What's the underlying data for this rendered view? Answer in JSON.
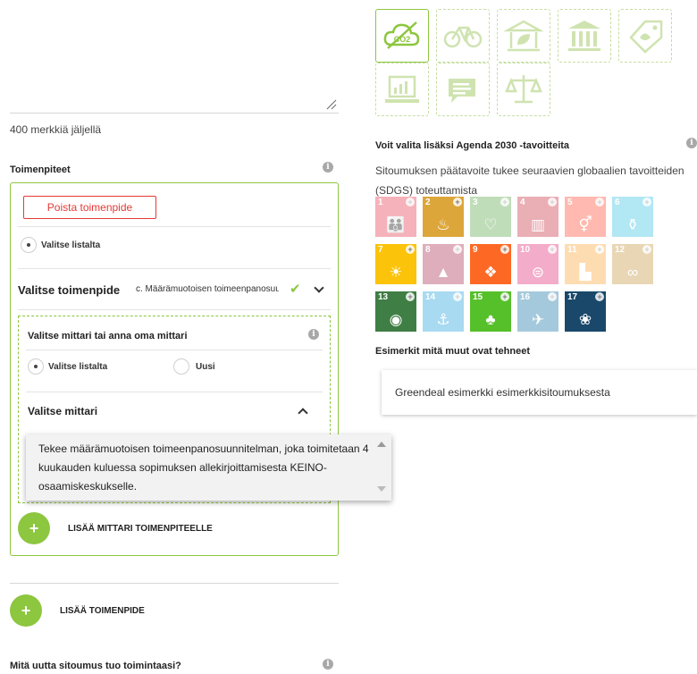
{
  "form": {
    "chars_left": "400 merkkiä jäljellä",
    "measures_label": "Toimenpiteet",
    "remove_measure": "Poista toimenpide",
    "choose_from_list": "Valitse listalta",
    "select_measure_label": "Valitse toimenpide",
    "select_measure_value": "c.   Määrämuotoisen toimeenpanosuunnitelman",
    "metric_title": "Valitse mittari tai anna oma mittari",
    "metric_from_list": "Valitse listalta",
    "metric_new": "Uusi",
    "select_metric": "Valitse mittari",
    "dropdown_option": "Tekee määrämuotoisen toimeenpanosuunnitelman, joka toimitetaan 4 kuukauden kuluessa sopimuksen allekirjoittamisesta KEINO-osaamiskeskukselle.",
    "add_metric": "LISÄÄ MITTARI TOIMENPITEELLE",
    "add_measure": "LISÄÄ TOIMENPIDE",
    "what_new": "Mitä uutta sitoumus tuo toimintaasi?",
    "info_glyph": "i",
    "plus_glyph": "+"
  },
  "categories": [
    {
      "name": "co2-icon",
      "selected": true
    },
    {
      "name": "bicycle-icon",
      "selected": false
    },
    {
      "name": "green-building-icon",
      "selected": false
    },
    {
      "name": "institution-icon",
      "selected": false
    },
    {
      "name": "tag-icon",
      "selected": false
    },
    {
      "name": "laptop-chart-icon",
      "selected": false
    },
    {
      "name": "chat-icon",
      "selected": false
    },
    {
      "name": "scales-icon",
      "selected": false
    }
  ],
  "sdg": {
    "heading": "Voit valita lisäksi Agenda 2030 -tavoitteita",
    "description_1": "Sitoumuksen päätavoite tukee seuraavien globaalien tavoitteiden",
    "description_2": "(SDGS) toteuttamista",
    "goals": [
      {
        "num": "1",
        "color": "#e5243b",
        "glyph": "👪",
        "active": false
      },
      {
        "num": "2",
        "color": "#dda63a",
        "glyph": "♨",
        "active": true
      },
      {
        "num": "3",
        "color": "#4c9f38",
        "glyph": "♡",
        "active": false
      },
      {
        "num": "4",
        "color": "#c5192d",
        "glyph": "▥",
        "active": false
      },
      {
        "num": "5",
        "color": "#ff3a21",
        "glyph": "⚥",
        "active": false
      },
      {
        "num": "6",
        "color": "#26bde2",
        "glyph": "⚱",
        "active": false
      },
      {
        "num": "7",
        "color": "#fcc30b",
        "glyph": "☀",
        "active": true
      },
      {
        "num": "8",
        "color": "#a21942",
        "glyph": "▲",
        "active": false
      },
      {
        "num": "9",
        "color": "#fd6925",
        "glyph": "❖",
        "active": true
      },
      {
        "num": "10",
        "color": "#dd1367",
        "glyph": "⊜",
        "active": false
      },
      {
        "num": "11",
        "color": "#fd9d24",
        "glyph": "▙",
        "active": false
      },
      {
        "num": "12",
        "color": "#bf8b2e",
        "glyph": "∞",
        "active": false
      },
      {
        "num": "13",
        "color": "#3f7e44",
        "glyph": "◉",
        "active": true
      },
      {
        "num": "14",
        "color": "#0a97d9",
        "glyph": "⚓",
        "active": false
      },
      {
        "num": "15",
        "color": "#56c02b",
        "glyph": "♣",
        "active": true
      },
      {
        "num": "16",
        "color": "#00689d",
        "glyph": "✈",
        "active": false
      },
      {
        "num": "17",
        "color": "#19486a",
        "glyph": "❀",
        "active": true
      }
    ]
  },
  "examples": {
    "heading": "Esimerkit mitä muut ovat tehneet",
    "card": "Greendeal esimerkki esimerkkisitoumuksesta"
  },
  "colors": {
    "accent": "#8dc63f",
    "danger": "#e53935"
  }
}
